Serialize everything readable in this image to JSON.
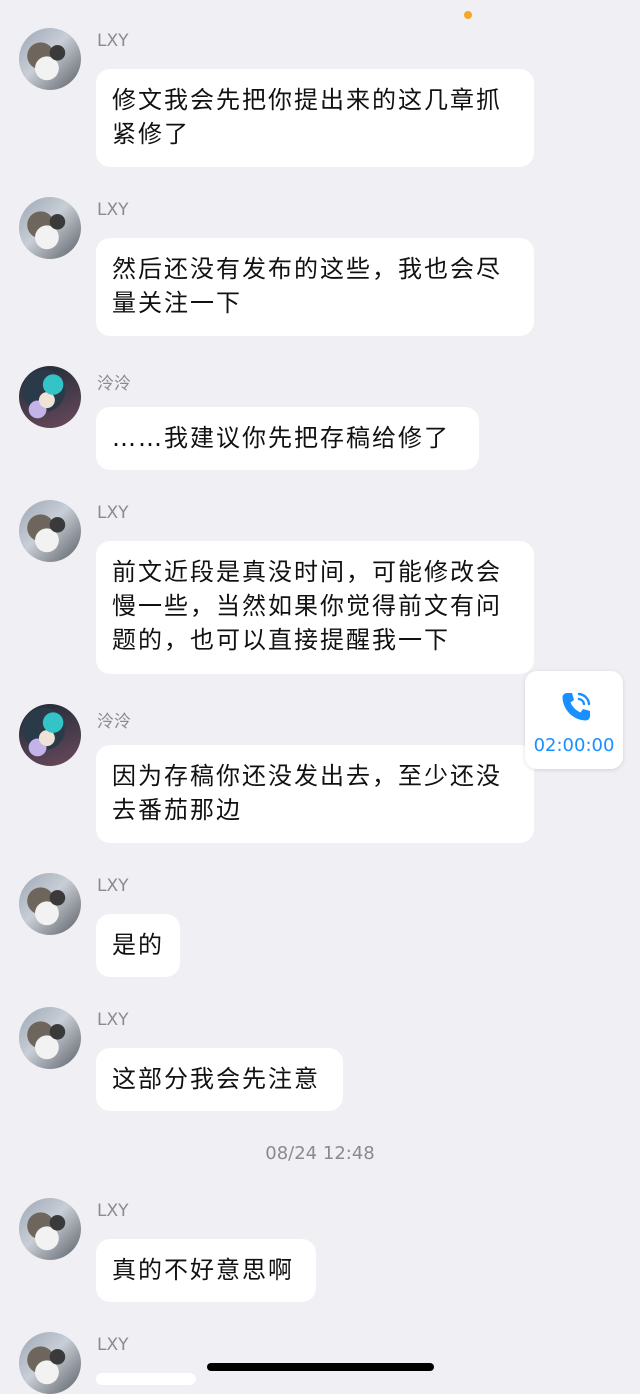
{
  "messages": [
    {
      "sender": "LXY",
      "avatar": "cat",
      "text": "修文我会先把你提出来的这几章抓\n紧修了"
    },
    {
      "sender": "LXY",
      "avatar": "cat",
      "text": "然后还没有发布的这些，我也会尽\n量关注一下"
    },
    {
      "sender": "泠泠",
      "avatar": "anime",
      "text": "……我建议你先把存稿给修了"
    },
    {
      "sender": "LXY",
      "avatar": "cat",
      "text": "前文近段是真没时间，可能修改会\n慢一些，当然如果你觉得前文有问\n题的，也可以直接提醒我一下"
    },
    {
      "sender": "泠泠",
      "avatar": "anime",
      "text": "因为存稿你还没发出去，至少还没\n去番茄那边"
    },
    {
      "sender": "LXY",
      "avatar": "cat",
      "text": "是的"
    },
    {
      "sender": "LXY",
      "avatar": "cat",
      "text": "这部分我会先注意"
    },
    {
      "sender": "LXY",
      "avatar": "cat",
      "text": "真的不好意思啊"
    },
    {
      "sender": "LXY",
      "avatar": "cat",
      "text": ""
    }
  ],
  "timestamp": "08/24 12:48",
  "call": {
    "duration": "02:00:00",
    "icon": "phone-icon"
  },
  "colors": {
    "background": "#efeff4",
    "bubble": "#ffffff",
    "accent": "#1890ff",
    "status_dot": "#f5a623"
  }
}
